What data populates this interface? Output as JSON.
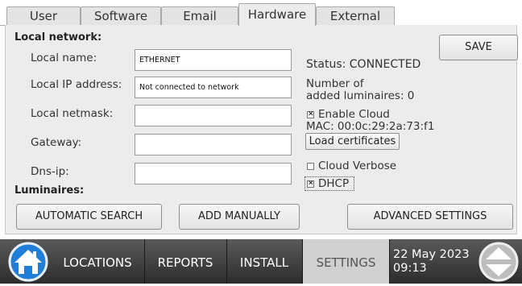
{
  "tabs": [
    {
      "label": "User"
    },
    {
      "label": "Software"
    },
    {
      "label": "Email"
    },
    {
      "label": "Hardware"
    },
    {
      "label": "External"
    }
  ],
  "active_tab": "Hardware",
  "section_local_network": "Local network:",
  "fields": {
    "local_name": {
      "label": "Local name:",
      "value": "ETHERNET"
    },
    "local_ip": {
      "label": "Local IP address:",
      "value": "Not connected to network"
    },
    "local_netmask": {
      "label": "Local netmask:",
      "value": ""
    },
    "gateway": {
      "label": "Gateway:",
      "value": ""
    },
    "dns_ip": {
      "label": "Dns-ip:",
      "value": ""
    }
  },
  "section_luminaires": "Luminaires:",
  "save_label": "SAVE",
  "status_text": "Status:  CONNECTED",
  "luminaires_count": {
    "line1": "Number of",
    "line2": "added luminaires:  0"
  },
  "enable_cloud": {
    "label": "Enable Cloud",
    "checked": true
  },
  "mac_text": "MAC: 00:0c:29:2a:73:f1",
  "load_certificates_label": "Load certificates",
  "cloud_verbose": {
    "label": "Cloud Verbose",
    "checked": false
  },
  "dhcp": {
    "label": "DHCP",
    "checked": true
  },
  "buttons": {
    "automatic_search": "AUTOMATIC SEARCH",
    "add_manually": "ADD MANUALLY",
    "advanced_settings": "ADVANCED SETTINGS"
  },
  "nav": {
    "locations": "LOCATIONS",
    "reports": "REPORTS",
    "install": "INSTALL",
    "settings": "SETTINGS"
  },
  "datetime": {
    "date": "22 May 2023",
    "time": "09:13"
  },
  "icons": {
    "home": "home-icon",
    "scroll": "up-down-arrows-icon"
  },
  "colors": {
    "nav_bg": "#3c3c3c",
    "nav_active": "#d0d0d0",
    "home_blue": "#1f7fd8"
  }
}
